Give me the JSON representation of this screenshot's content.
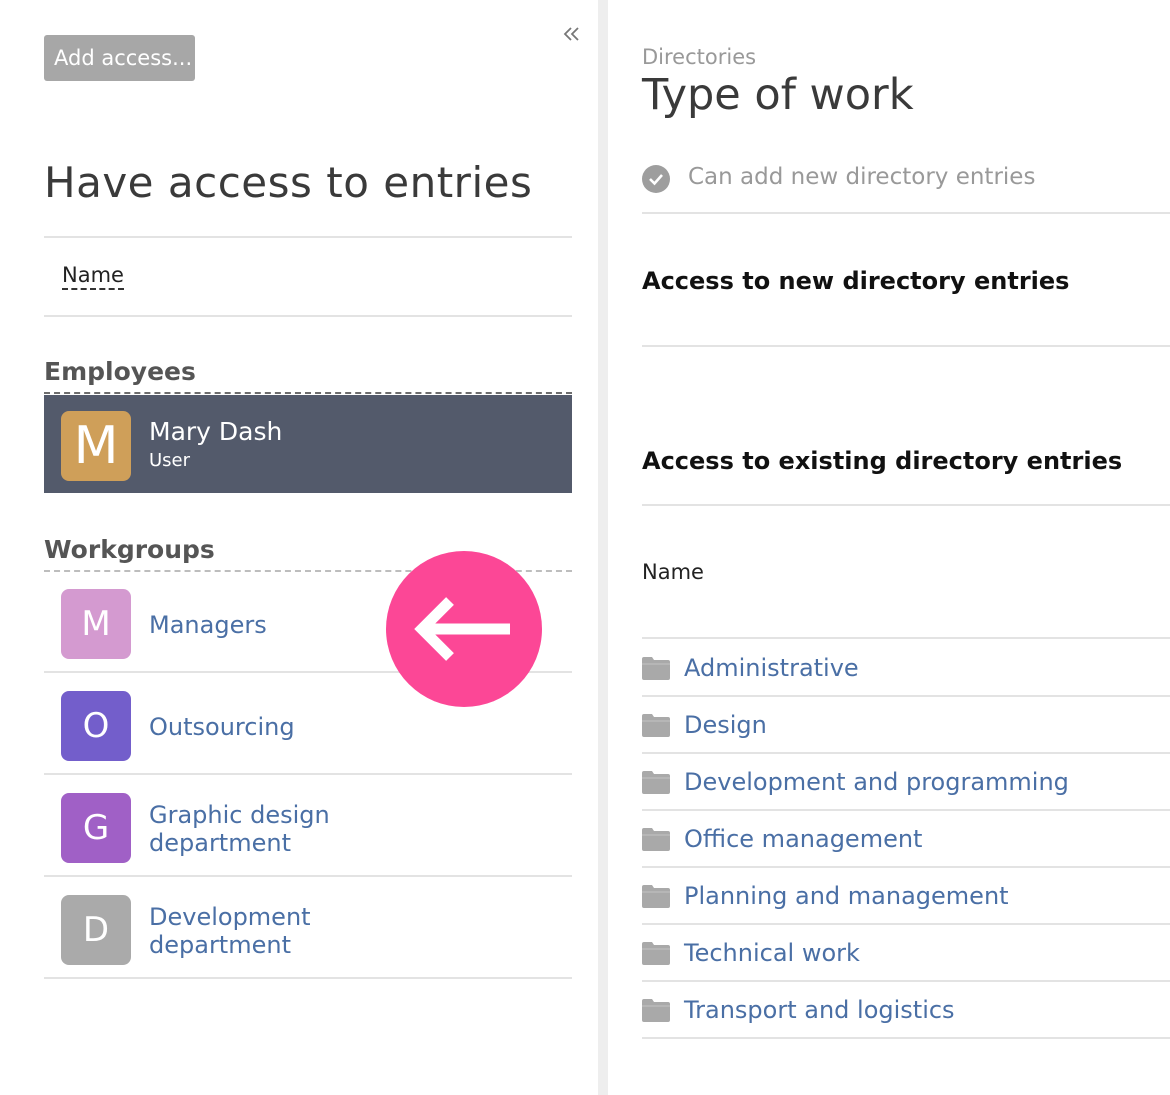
{
  "left": {
    "add_button": "Add access...",
    "collapse_icon": "double-chevron-left-icon",
    "title": "Have access to entries",
    "sort_label": "Name",
    "employees_heading": "Employees",
    "employees": [
      {
        "initial": "M",
        "name": "Mary Dash",
        "role": "User",
        "color": "#cf9f59"
      }
    ],
    "workgroups_heading": "Workgroups",
    "workgroups": [
      {
        "initial": "M",
        "name": "Managers",
        "color": "#d49ad0"
      },
      {
        "initial": "O",
        "name": "Outsourcing",
        "color": "#735ecb"
      },
      {
        "initial": "G",
        "name": "Graphic design\ndepartment",
        "color": "#a060c6"
      },
      {
        "initial": "D",
        "name": "Development\ndepartment",
        "color": "#aaaaaa"
      }
    ],
    "back_button_icon": "arrow-left-icon",
    "back_button_color": "#fc4796"
  },
  "right": {
    "breadcrumb": "Directories",
    "title": "Type of work",
    "permission": "Can add new directory entries",
    "new_entries_heading": "Access to new directory entries",
    "existing_entries_heading": "Access to existing directory entries",
    "column_name": "Name",
    "entries": [
      "Administrative",
      "Design",
      "Development and programming",
      "Office management",
      "Planning and management",
      "Technical work",
      "Transport and logistics"
    ]
  },
  "colors": {
    "link": "#4a6fa5",
    "selected_row": "#535a6b",
    "accent_pink": "#fc4796"
  }
}
